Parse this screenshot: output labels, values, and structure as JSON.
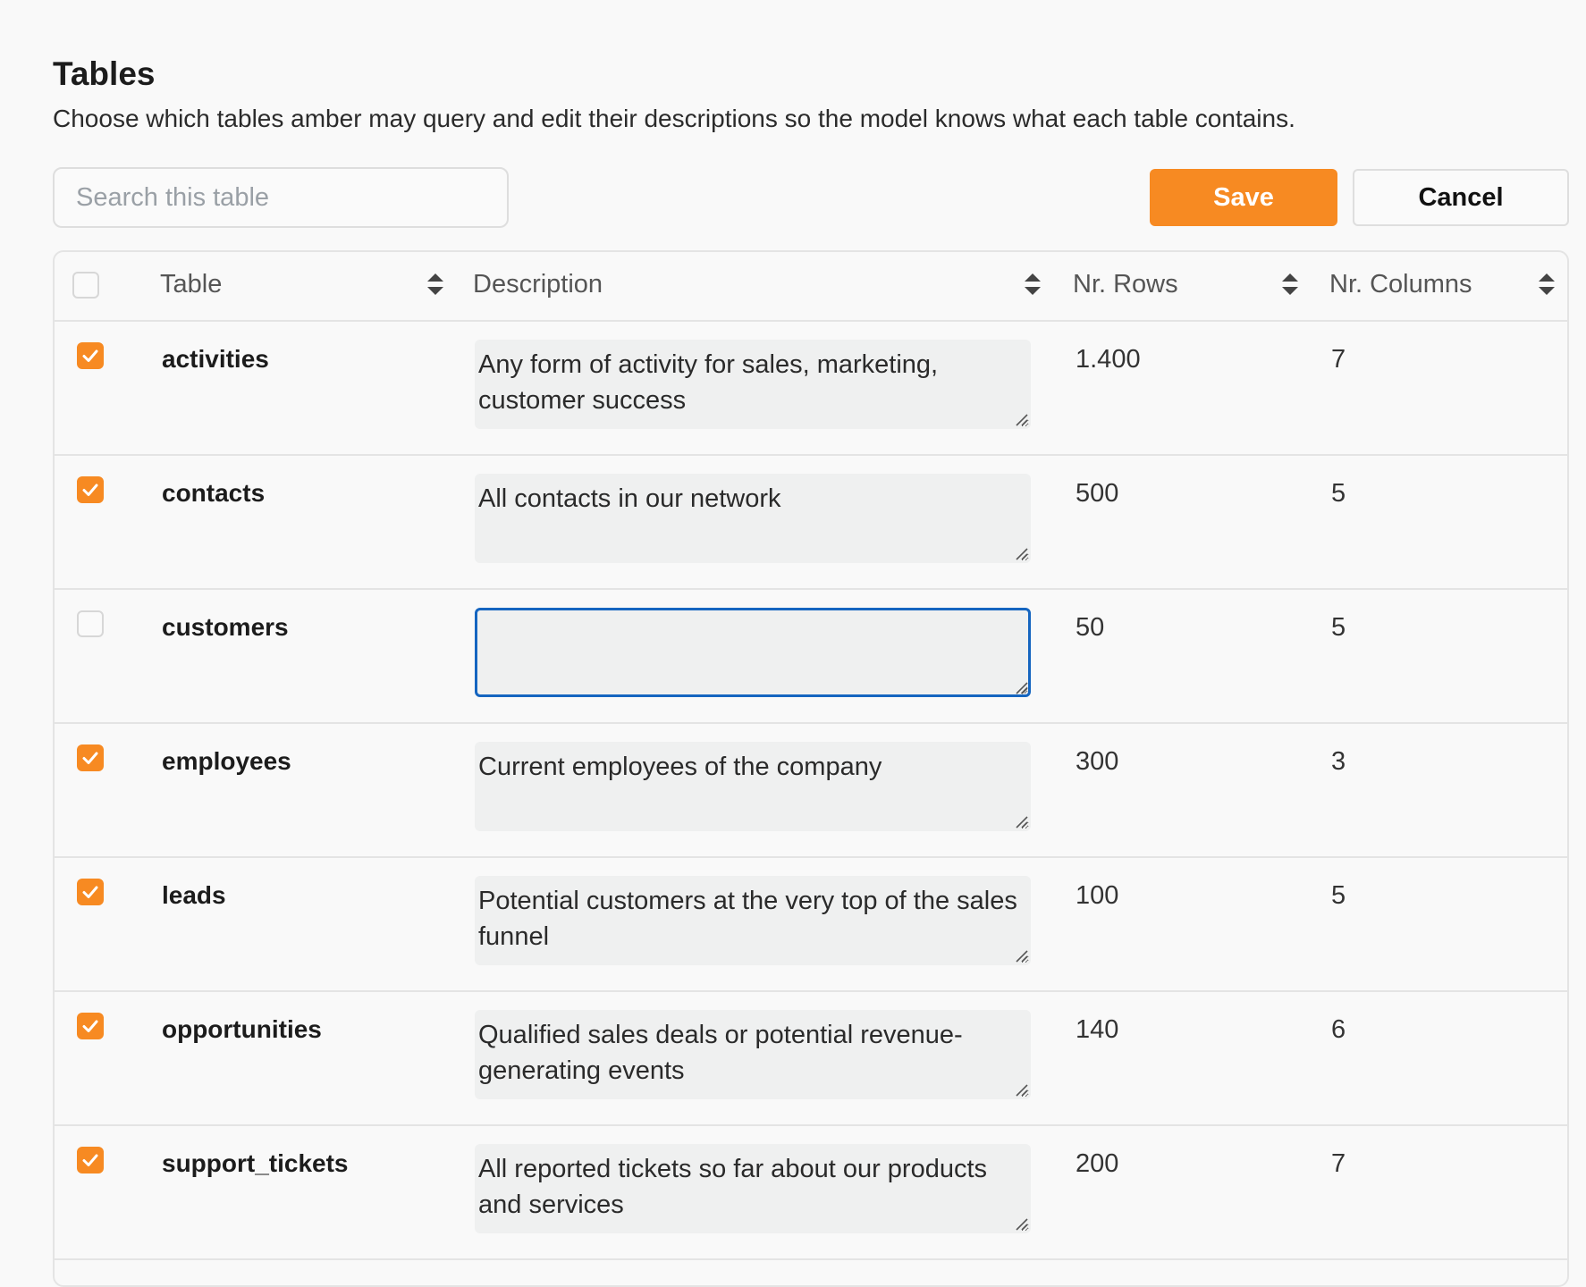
{
  "header": {
    "title": "Tables",
    "subtitle": "Choose which tables amber may query and edit their descriptions so the model knows what each table contains."
  },
  "search": {
    "placeholder": "Search this table",
    "value": ""
  },
  "actions": {
    "save_label": "Save",
    "cancel_label": "Cancel"
  },
  "colors": {
    "accent": "#f78a22",
    "focus": "#1565c0",
    "textarea_bg": "#eff0f0"
  },
  "table": {
    "columns": [
      "Table",
      "Description",
      "Nr. Rows",
      "Nr. Columns"
    ],
    "select_all_checked": false,
    "rows": [
      {
        "checked": true,
        "name": "activities",
        "description": "Any form of activity for sales, marketing, customer success",
        "nr_rows": "1.400",
        "nr_columns": "7"
      },
      {
        "checked": true,
        "name": "contacts",
        "description": "All contacts in our network",
        "nr_rows": "500",
        "nr_columns": "5"
      },
      {
        "checked": false,
        "name": "customers",
        "description": "",
        "nr_rows": "50",
        "nr_columns": "5",
        "focused": true
      },
      {
        "checked": true,
        "name": "employees",
        "description": "Current employees of the company",
        "nr_rows": "300",
        "nr_columns": "3"
      },
      {
        "checked": true,
        "name": "leads",
        "description": "Potential customers at the very top of the sales funnel",
        "nr_rows": "100",
        "nr_columns": "5"
      },
      {
        "checked": true,
        "name": "opportunities",
        "description": "Qualified sales deals or potential revenue-generating events",
        "nr_rows": "140",
        "nr_columns": "6"
      },
      {
        "checked": true,
        "name": "support_tickets",
        "description": "All reported tickets so far about our products and services",
        "nr_rows": "200",
        "nr_columns": "7"
      }
    ]
  }
}
